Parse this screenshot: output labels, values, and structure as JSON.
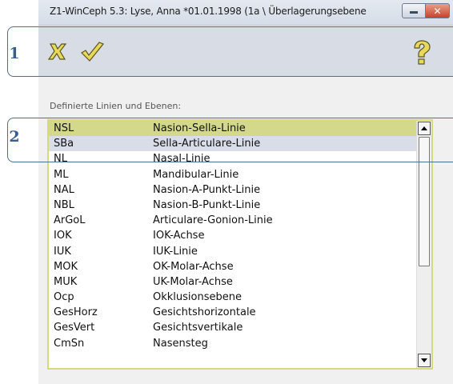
{
  "window": {
    "title": "Z1-WinCeph 5.3: Lyse, Anna *01.01.1998 (1a \\ Überlagerungsebene",
    "minimize_icon": "minimize-icon",
    "close_icon": "close-icon"
  },
  "toolbar": {
    "cancel_icon": "cross-icon",
    "ok_icon": "checkmark-icon",
    "help_icon": "question-mark-icon"
  },
  "callouts": [
    "1",
    "2"
  ],
  "list": {
    "label": "Definierte Linien und Ebenen:",
    "rows": [
      {
        "abbr": "NSL",
        "desc": "Nasion-Sella-Linie",
        "state": "selected"
      },
      {
        "abbr": "SBa",
        "desc": "Sella-Articulare-Linie",
        "state": "alt"
      },
      {
        "abbr": "NL",
        "desc": "Nasal-Linie",
        "state": ""
      },
      {
        "abbr": "ML",
        "desc": "Mandibular-Linie",
        "state": ""
      },
      {
        "abbr": "NAL",
        "desc": "Nasion-A-Punkt-Linie",
        "state": ""
      },
      {
        "abbr": "NBL",
        "desc": "Nasion-B-Punkt-Linie",
        "state": ""
      },
      {
        "abbr": "ArGoL",
        "desc": "Articulare-Gonion-Linie",
        "state": ""
      },
      {
        "abbr": "IOK",
        "desc": "IOK-Achse",
        "state": ""
      },
      {
        "abbr": "IUK",
        "desc": "IUK-Linie",
        "state": ""
      },
      {
        "abbr": "MOK",
        "desc": "OK-Molar-Achse",
        "state": ""
      },
      {
        "abbr": "MUK",
        "desc": "UK-Molar-Achse",
        "state": ""
      },
      {
        "abbr": "Ocp",
        "desc": "Okklusionsebene",
        "state": ""
      },
      {
        "abbr": "GesHorz",
        "desc": "Gesichtshorizontale",
        "state": ""
      },
      {
        "abbr": "GesVert",
        "desc": "Gesichtsvertikale",
        "state": ""
      },
      {
        "abbr": "CmSn",
        "desc": "Nasensteg",
        "state": ""
      }
    ]
  },
  "colors": {
    "selected_row": "#d4d88a",
    "alt_row": "#d8dde8",
    "callout_border": "#4d6e97",
    "toolbar_bg": "#d8dde5"
  }
}
